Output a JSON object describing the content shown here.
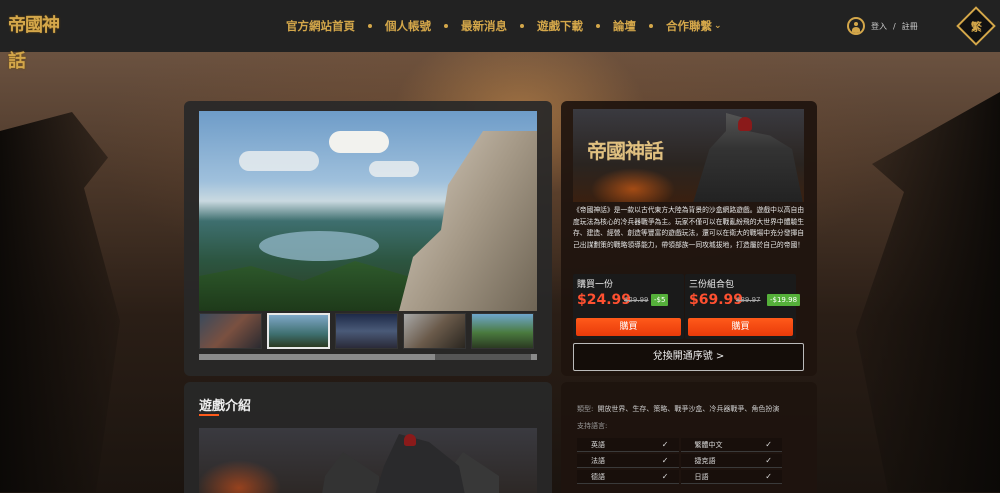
{
  "header": {
    "logo_text": "帝國神話",
    "nav": [
      {
        "label": "官方網站首頁"
      },
      {
        "label": "個人帳號"
      },
      {
        "label": "最新消息"
      },
      {
        "label": "遊戲下載"
      },
      {
        "label": "論壇"
      },
      {
        "label": "合作聯繫"
      }
    ],
    "login_label": "登入",
    "separator": "/",
    "register_label": "註冊",
    "language_badge": "繁"
  },
  "media": {
    "thumbnails": [
      "thumbnail-1",
      "thumbnail-2",
      "thumbnail-3",
      "thumbnail-4",
      "thumbnail-5"
    ],
    "active_thumbnail_index": 1,
    "scroll_progress": 0.7
  },
  "product": {
    "cover_title": "帝國神話",
    "description": "《帝國神話》是一款以古代東方大陸為背景的沙盒網路遊戲。遊戲中以高自由度玩法為核心的冷兵器戰爭為主。玩家不僅可以在戰亂紛飛的大世界中體驗生存、建造、經營、創造等豐富的遊戲玩法，還可以在衛大的戰場中充分發揮自己出謀劃策的戰略領導能力，帶領部族一同攻城拔地，打造屬於自己的帝國！",
    "offers": [
      {
        "label": "購買一份",
        "price": "$24.99",
        "old_price": "$29.99",
        "save": "-$5",
        "button": "購買"
      },
      {
        "label": "三份組合包",
        "price": "$69.99",
        "old_price": "$89.97",
        "save": "-$19.98",
        "button": "購買"
      }
    ],
    "redeem_label": "兌換開通序號 >"
  },
  "intro": {
    "title": "遊戲介紹"
  },
  "info": {
    "genre_key": "類型:",
    "genre_value": "開放世界、生存、策略、戰爭沙盒、冷兵器戰爭、角色扮演",
    "lang_label": "支持語言:",
    "languages": [
      {
        "name": "英語",
        "check": "✓"
      },
      {
        "name": "繁體中文",
        "check": "✓"
      },
      {
        "name": "法語",
        "check": "✓"
      },
      {
        "name": "捷克語",
        "check": "✓"
      },
      {
        "name": "德語",
        "check": "✓"
      },
      {
        "name": "日語",
        "check": "✓"
      }
    ]
  },
  "colors": {
    "accent_gold": "#d4a74a",
    "price_red": "#ff5030",
    "buy_orange": "#ff5a1a",
    "save_green": "#55b03a"
  }
}
